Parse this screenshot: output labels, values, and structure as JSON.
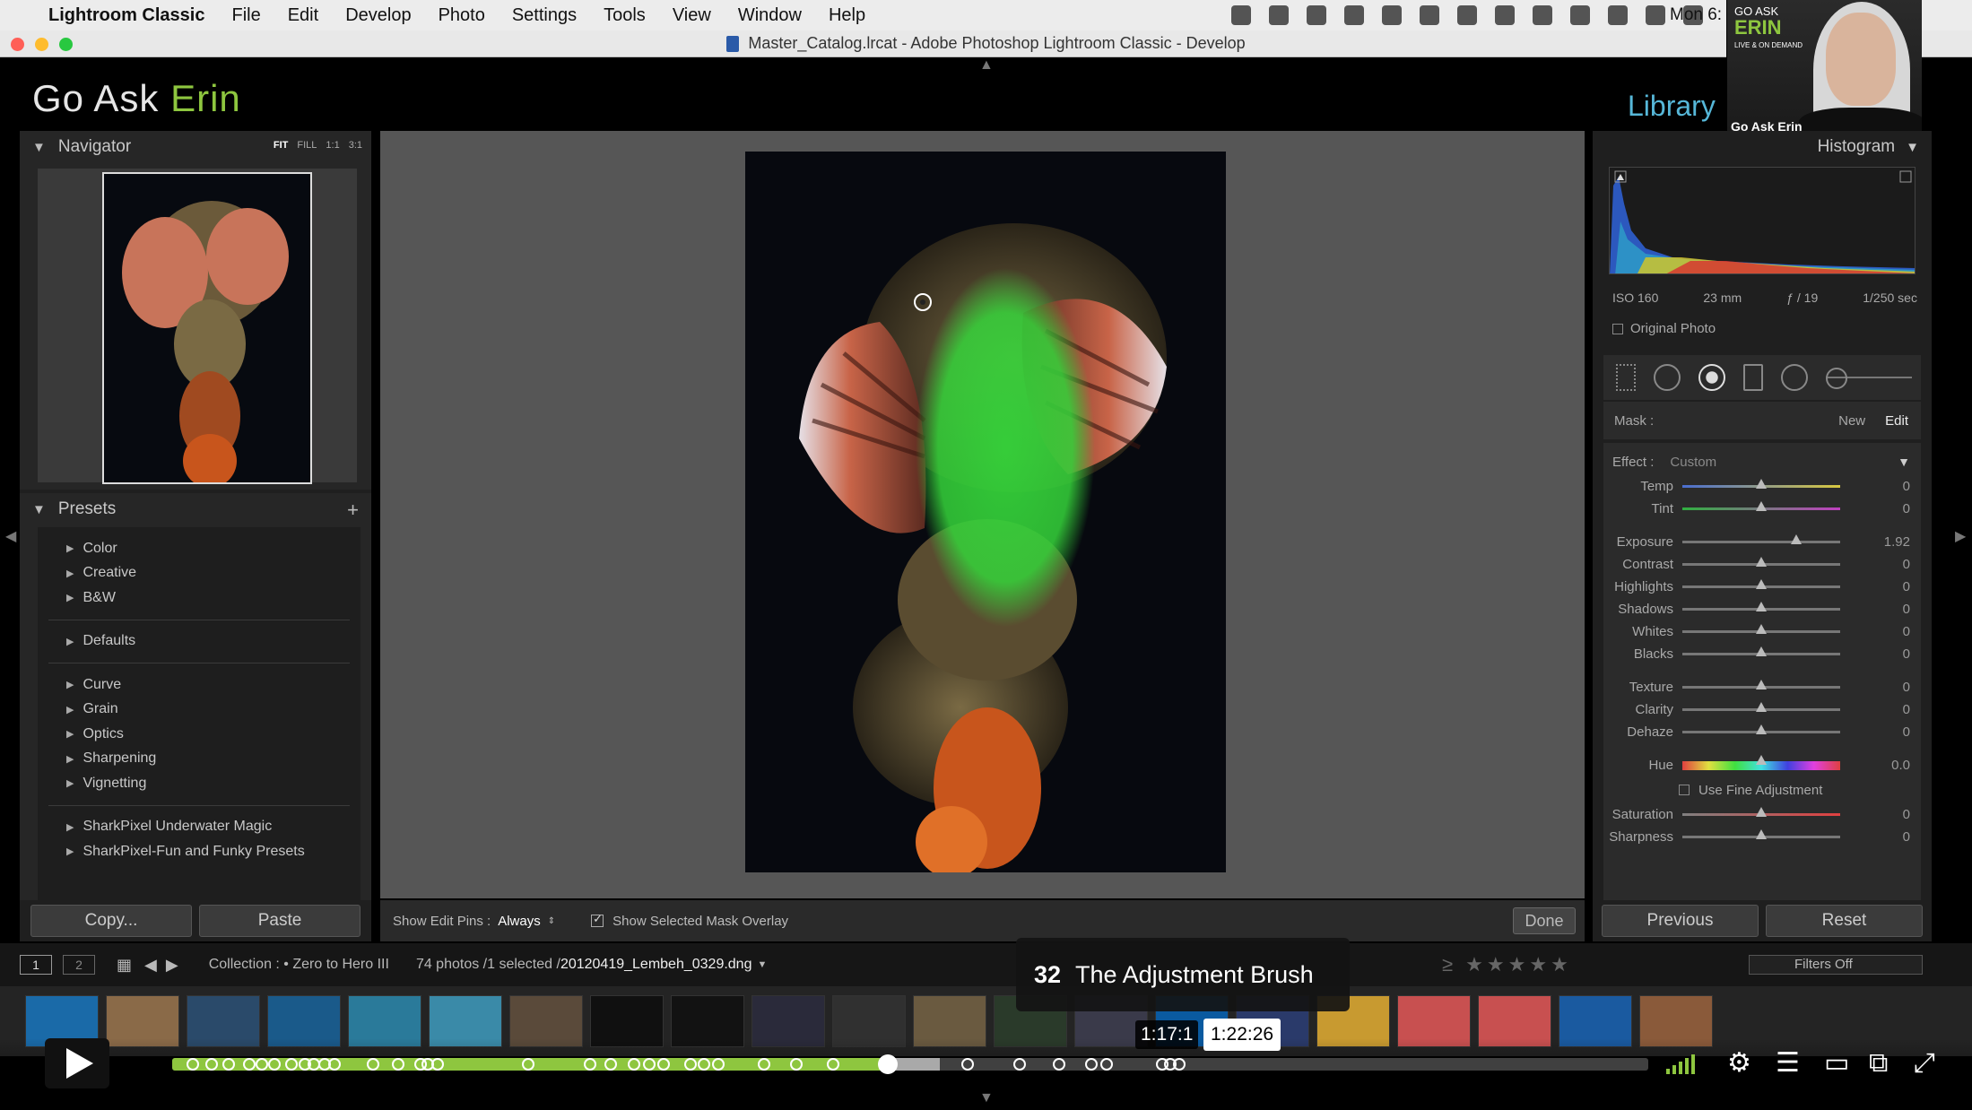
{
  "menubar": {
    "apple": "",
    "app_name": "Lightroom Classic",
    "items": [
      "File",
      "Edit",
      "Develop",
      "Photo",
      "Settings",
      "Tools",
      "View",
      "Window",
      "Help"
    ],
    "clock": "Mon 6:"
  },
  "window": {
    "title": "Master_Catalog.lrcat - Adobe Photoshop Lightroom Classic - Develop"
  },
  "identity": {
    "plate_part1": "Go Ask ",
    "plate_part2": "Erin",
    "active_module": "Library"
  },
  "webcam": {
    "logo_top": "GO ASK",
    "logo_main": "ERIN",
    "logo_sub": "LIVE & ON DEMAND",
    "name_label": "Go Ask Erin"
  },
  "navigator": {
    "title": "Navigator",
    "zoom_options": [
      "FIT",
      "FILL",
      "1:1",
      "3:1"
    ],
    "zoom_active": "FIT"
  },
  "presets": {
    "title": "Presets",
    "plus": "+",
    "groups": [
      [
        "Color",
        "Creative",
        "B&W"
      ],
      [
        "Defaults"
      ],
      [
        "Curve",
        "Grain",
        "Optics",
        "Sharpening",
        "Vignetting"
      ],
      [
        "SharkPixel Underwater Magic",
        "SharkPixel-Fun and Funky Presets"
      ]
    ]
  },
  "left_buttons": {
    "copy": "Copy...",
    "paste": "Paste"
  },
  "center_toolbar": {
    "edit_pins_label": "Show Edit Pins :",
    "edit_pins_value": "Always",
    "mask_overlay_label": "Show Selected Mask Overlay",
    "mask_overlay_checked": true,
    "done_label": "Done"
  },
  "histogram": {
    "title": "Histogram",
    "iso": "ISO 160",
    "focal": "23 mm",
    "aperture": "ƒ / 19",
    "shutter": "1/250 sec",
    "original_photo_label": "Original Photo"
  },
  "mask": {
    "label": "Mask :",
    "new": "New",
    "edit": "Edit"
  },
  "adjustments": {
    "effect_label": "Effect :",
    "effect_value": "Custom",
    "fine_adjust_label": "Use Fine Adjustment",
    "sliders": [
      {
        "label": "Temp",
        "value": "0",
        "pos": 0.5,
        "track": "temp"
      },
      {
        "label": "Tint",
        "value": "0",
        "pos": 0.5,
        "track": "tint"
      },
      {
        "label": "Exposure",
        "value": "1.92",
        "pos": 0.72,
        "track": "gray"
      },
      {
        "label": "Contrast",
        "value": "0",
        "pos": 0.5,
        "track": "gray"
      },
      {
        "label": "Highlights",
        "value": "0",
        "pos": 0.5,
        "track": "gray"
      },
      {
        "label": "Shadows",
        "value": "0",
        "pos": 0.5,
        "track": "gray"
      },
      {
        "label": "Whites",
        "value": "0",
        "pos": 0.5,
        "track": "gray"
      },
      {
        "label": "Blacks",
        "value": "0",
        "pos": 0.5,
        "track": "gray"
      },
      {
        "label": "Texture",
        "value": "0",
        "pos": 0.5,
        "track": "gray"
      },
      {
        "label": "Clarity",
        "value": "0",
        "pos": 0.5,
        "track": "gray"
      },
      {
        "label": "Dehaze",
        "value": "0",
        "pos": 0.5,
        "track": "gray"
      },
      {
        "label": "Hue",
        "value": "0.0",
        "pos": 0.5,
        "track": "hue"
      },
      {
        "label": "Saturation",
        "value": "0",
        "pos": 0.5,
        "track": "sat"
      },
      {
        "label": "Sharpness",
        "value": "0",
        "pos": 0.5,
        "track": "gray"
      }
    ]
  },
  "right_buttons": {
    "previous": "Previous",
    "reset": "Reset"
  },
  "filmbar": {
    "screen1": "1",
    "screen2": "2",
    "source": "Collection : • Zero to Hero III",
    "count": "74 photos /1 selected /",
    "filename": "20120419_Lembeh_0329.dng",
    "stars": "≥ ★★★★★",
    "filters": "Filters Off"
  },
  "video": {
    "chapter_number": "32",
    "chapter_title": "The Adjustment Brush",
    "current_time": "1:17:1",
    "hover_time": "1:22:26",
    "progress": 0.485,
    "hover_progress": 0.52,
    "chapters": [
      0.014,
      0.027,
      0.038,
      0.052,
      0.061,
      0.069,
      0.081,
      0.09,
      0.096,
      0.103,
      0.11,
      0.136,
      0.153,
      0.168,
      0.173,
      0.18,
      0.241,
      0.283,
      0.297,
      0.313,
      0.323,
      0.333,
      0.351,
      0.36,
      0.37,
      0.401,
      0.423,
      0.448,
      0.539,
      0.574,
      0.601,
      0.623,
      0.633,
      0.671,
      0.676,
      0.682
    ]
  },
  "colors": {
    "accent_green": "#8ec63f",
    "library_blue": "#56b7d8",
    "mask_green": "#35d43a"
  }
}
